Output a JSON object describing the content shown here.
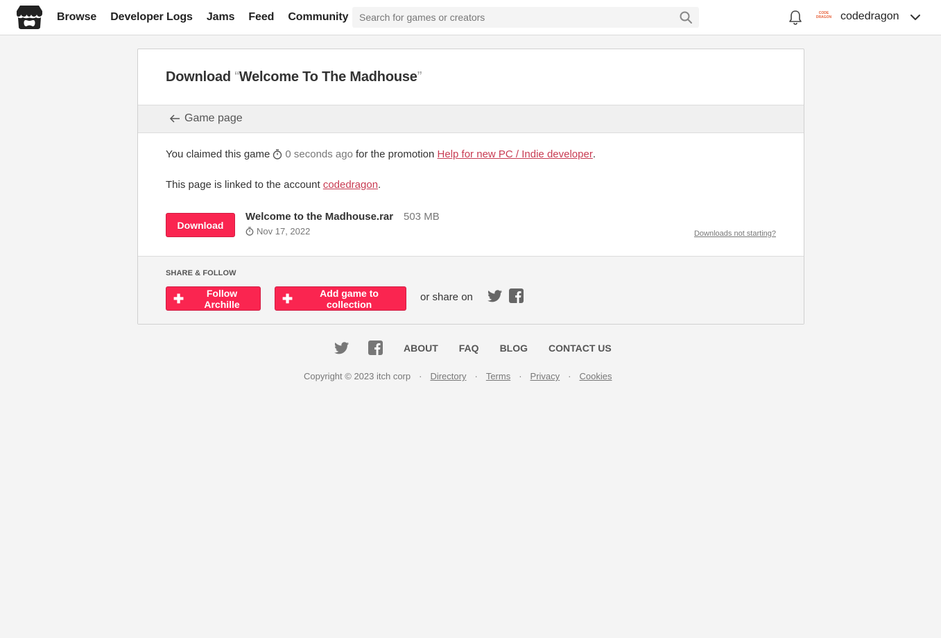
{
  "header": {
    "nav": [
      "Browse",
      "Developer Logs",
      "Jams",
      "Feed",
      "Community"
    ],
    "search_placeholder": "Search for games or creators",
    "avatar_text": "CODE DRAGON",
    "username": "codedragon"
  },
  "card": {
    "title_prefix": "Download",
    "open_quote": "“",
    "game_title": "Welcome To The Madhouse",
    "close_quote": "”",
    "back_label": "Game page",
    "claim_text": "You claimed this game",
    "claim_time": "0 seconds ago",
    "claim_mid": "for the promotion",
    "promotion_link": "Help for new PC / Indie developer",
    "claim_end": ".",
    "linked_text": "This page is linked to the account",
    "linked_account": "codedragon",
    "linked_end": ".",
    "download_label": "Download",
    "file_name": "Welcome to the Madhouse.rar",
    "file_size": "503 MB",
    "file_date": "Nov 17, 2022",
    "not_starting": "Downloads not starting?"
  },
  "share": {
    "heading": "SHARE & FOLLOW",
    "follow_label": "Follow Archille",
    "collection_label": "Add game to collection",
    "share_on": "or share on"
  },
  "footer": {
    "links": [
      "ABOUT",
      "FAQ",
      "BLOG",
      "CONTACT US"
    ],
    "copyright": "Copyright © 2023 itch corp",
    "separator": "·",
    "legal": [
      "Directory",
      "Terms",
      "Privacy",
      "Cookies"
    ]
  },
  "colors": {
    "accent": "#fa2550",
    "link": "#c83b52",
    "background": "#f4f4f4"
  }
}
